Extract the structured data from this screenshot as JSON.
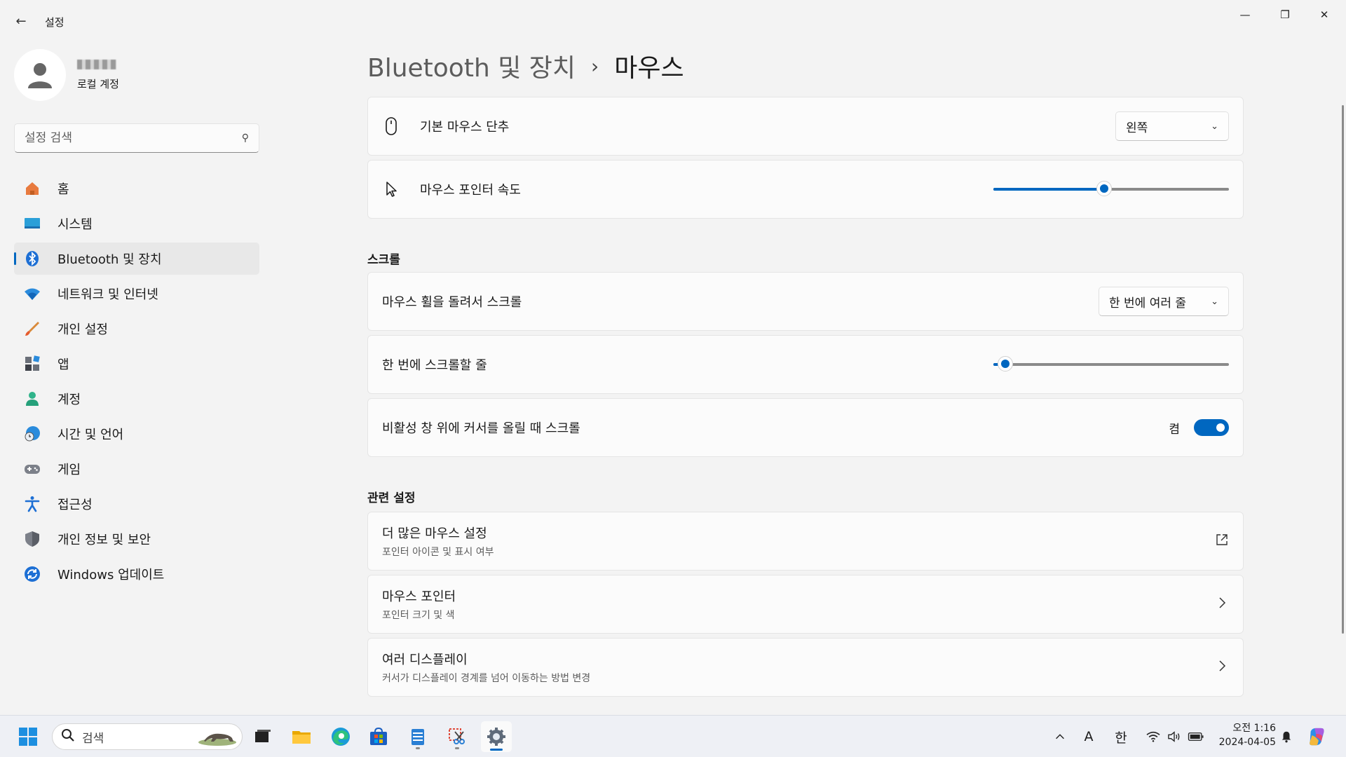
{
  "window": {
    "title": "설정"
  },
  "profile": {
    "name_obscured": "",
    "account_type": "로컬 계정"
  },
  "search": {
    "placeholder": "설정 검색"
  },
  "sidebar": {
    "items": [
      {
        "label": "홈",
        "icon": "home-icon",
        "active": false
      },
      {
        "label": "시스템",
        "icon": "system-icon",
        "active": false
      },
      {
        "label": "Bluetooth 및 장치",
        "icon": "bluetooth-icon",
        "active": true
      },
      {
        "label": "네트워크 및 인터넷",
        "icon": "wifi-icon",
        "active": false
      },
      {
        "label": "개인 설정",
        "icon": "brush-icon",
        "active": false
      },
      {
        "label": "앱",
        "icon": "apps-icon",
        "active": false
      },
      {
        "label": "계정",
        "icon": "account-icon",
        "active": false
      },
      {
        "label": "시간 및 언어",
        "icon": "time-language-icon",
        "active": false
      },
      {
        "label": "게임",
        "icon": "gamepad-icon",
        "active": false
      },
      {
        "label": "접근성",
        "icon": "accessibility-icon",
        "active": false
      },
      {
        "label": "개인 정보 및 보안",
        "icon": "shield-icon",
        "active": false
      },
      {
        "label": "Windows 업데이트",
        "icon": "update-icon",
        "active": false
      }
    ]
  },
  "breadcrumb": {
    "parent": "Bluetooth 및 장치",
    "separator": "›",
    "current": "마우스"
  },
  "settings": {
    "primary_button": {
      "label": "기본 마우스 단추",
      "value": "왼쪽"
    },
    "pointer_speed": {
      "label": "마우스 포인터 속도",
      "value_fraction": 0.47
    },
    "scroll_section": "스크롤",
    "wheel_scroll": {
      "label": "마우스 휠을 돌려서 스크롤",
      "value": "한 번에 여러 줄"
    },
    "lines_per_scroll": {
      "label": "한 번에 스크롤할 줄",
      "value_fraction": 0.05
    },
    "inactive_scroll": {
      "label": "비활성 창 위에 커서를 올릴 때 스크롤",
      "state_label": "켬",
      "on": true
    },
    "related_section": "관련 설정",
    "related": [
      {
        "title": "더 많은 마우스 설정",
        "subtitle": "포인터 아이콘 및 표시 여부",
        "icon": "external-link-icon"
      },
      {
        "title": "마우스 포인터",
        "subtitle": "포인터 크기 및 색",
        "icon": "chevron-right-icon"
      },
      {
        "title": "여러 디스플레이",
        "subtitle": "커서가 디스플레이 경계를 넘어 이동하는 방법 변경",
        "icon": "chevron-right-icon"
      }
    ]
  },
  "taskbar": {
    "search_label": "검색",
    "ime_mode": "A",
    "ime_lang": "한",
    "time": "오전 1:16",
    "date": "2024-04-05"
  },
  "colors": {
    "accent": "#0067c0",
    "background": "#f3f3f3",
    "card": "#fbfbfb"
  }
}
